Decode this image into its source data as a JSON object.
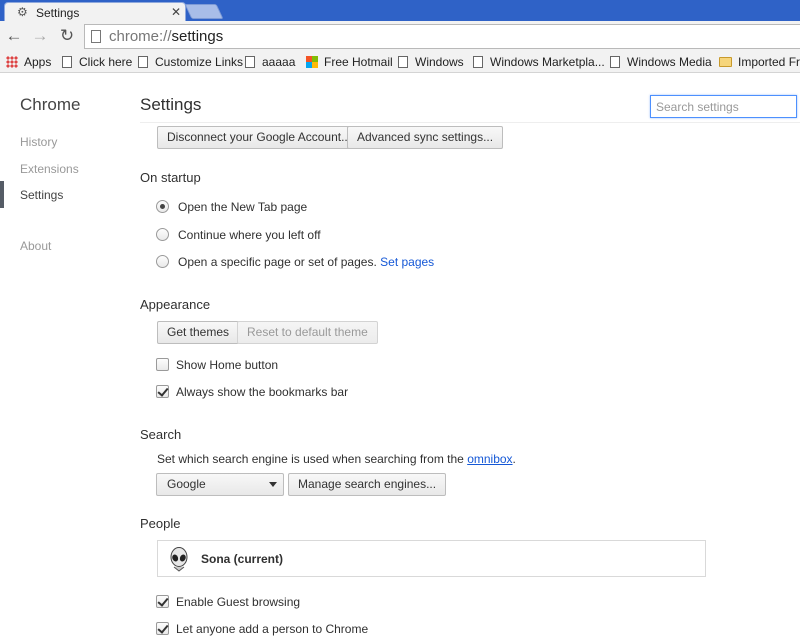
{
  "tab": {
    "title": "Settings",
    "icon": "gear-icon"
  },
  "toolbar": {
    "url_prefix": "chrome://",
    "url_path": "settings"
  },
  "bookmarks": [
    {
      "label": "Apps",
      "icon": "apps-grid-icon"
    },
    {
      "label": "Click here",
      "icon": "page-icon"
    },
    {
      "label": "Customize Links",
      "icon": "page-icon"
    },
    {
      "label": "aaaaa",
      "icon": "page-icon"
    },
    {
      "label": "Free Hotmail",
      "icon": "microsoft-logo-icon"
    },
    {
      "label": "Windows",
      "icon": "page-icon"
    },
    {
      "label": "Windows Marketpla...",
      "icon": "page-icon"
    },
    {
      "label": "Windows Media",
      "icon": "page-icon"
    },
    {
      "label": "Imported Fro",
      "icon": "folder-icon"
    }
  ],
  "sidebar": {
    "brand": "Chrome",
    "items": [
      {
        "label": "History"
      },
      {
        "label": "Extensions"
      },
      {
        "label": "Settings",
        "active": true
      },
      {
        "label": "About"
      }
    ]
  },
  "header": {
    "title": "Settings",
    "search_placeholder": "Search settings"
  },
  "sync": {
    "disconnect_label": "Disconnect your Google Account...",
    "advanced_label": "Advanced sync settings..."
  },
  "startup": {
    "title": "On startup",
    "options": [
      {
        "label": "Open the New Tab page",
        "checked": true
      },
      {
        "label": "Continue where you left off",
        "checked": false
      },
      {
        "label": "Open a specific page or set of pages.",
        "link": "Set pages",
        "checked": false
      }
    ]
  },
  "appearance": {
    "title": "Appearance",
    "get_themes": "Get themes",
    "reset_theme": "Reset to default theme",
    "show_home": {
      "label": "Show Home button",
      "checked": false
    },
    "show_bookmarks": {
      "label": "Always show the bookmarks bar",
      "checked": true
    }
  },
  "search": {
    "title": "Search",
    "description": "Set which search engine is used when searching from the",
    "omnibox_link": "omnibox",
    "period": ".",
    "engine": "Google",
    "manage_label": "Manage search engines..."
  },
  "people": {
    "title": "People",
    "profile_name": "Sona (current)",
    "guest": {
      "label": "Enable Guest browsing",
      "checked": true
    },
    "add_person": {
      "label": "Let anyone add a person to Chrome",
      "checked": true
    }
  }
}
